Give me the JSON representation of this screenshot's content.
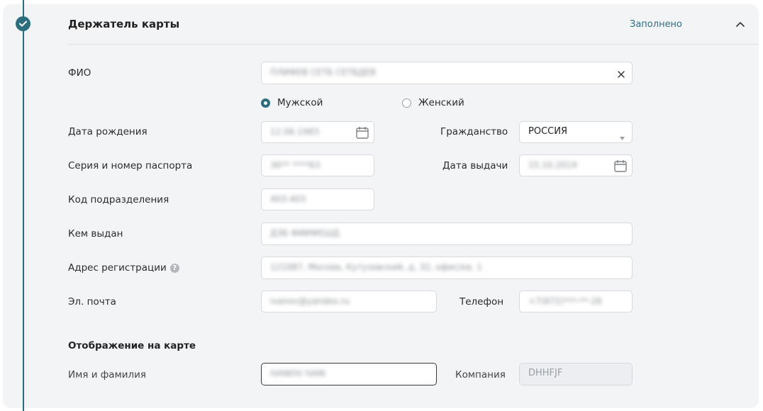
{
  "card": {
    "title": "Держатель карты",
    "status": "Заполнено",
    "accent_color": "#2c6e7e"
  },
  "form": {
    "fio": {
      "label": "ФИО",
      "value": "ПЛИФЕВ СЕТБ СЕТБДЕВ"
    },
    "gender": {
      "male": "Мужской",
      "female": "Женский",
      "selected": "Мужской"
    },
    "birth_date": {
      "label": "Дата рождения",
      "value": "12.06.1983"
    },
    "citizenship": {
      "label": "Гражданство",
      "value": "РОССИЯ"
    },
    "passport": {
      "label": "Серия и номер паспорта",
      "value": "36** ****63"
    },
    "issue_date": {
      "label": "Дата выдачи",
      "value": "15.10.2019"
    },
    "division_code": {
      "label": "Код подразделения",
      "value": "403-403"
    },
    "issued_by": {
      "label": "Кем выдан",
      "value": "ДЗБ ФИИФЕШД"
    },
    "address": {
      "label": "Адрес регистрации",
      "value": "121087, Москва, Кутузовский, д. 32, офис/кв. 1"
    },
    "email": {
      "label": "Эл. почта",
      "value": "ivanov@yandex.ru"
    },
    "phone": {
      "label": "Телефон",
      "value": "+7(872)***-**-26"
    }
  },
  "display": {
    "section_title": "Отображение на карте",
    "name": {
      "label": "Имя и фамилия",
      "value": "IVANOV IVAN"
    },
    "company": {
      "label": "Компания",
      "value": "DHHFJF"
    }
  }
}
